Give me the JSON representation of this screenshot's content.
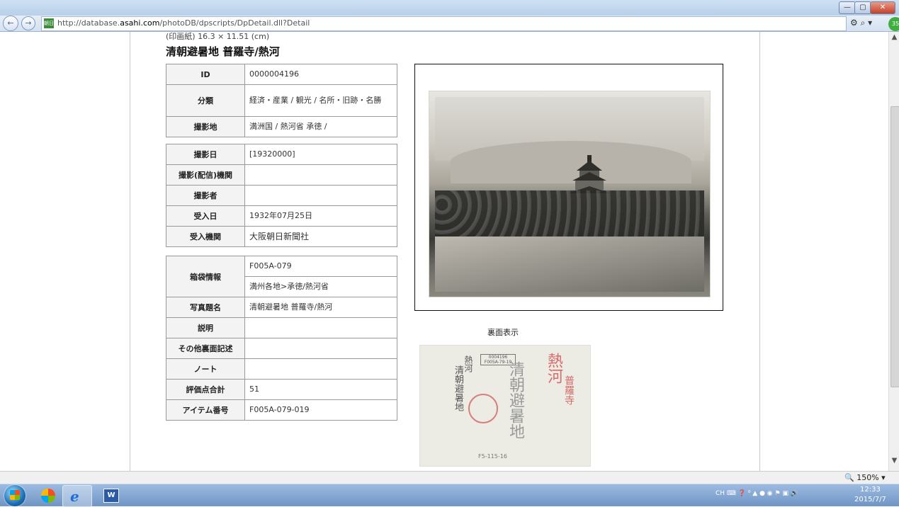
{
  "browser": {
    "url_prefix": "http://database.",
    "url_domain": "asahi.com",
    "url_path": "/photoDB/dpscripts/DpDetail.dll?Detail",
    "site_icon_text": "朝日",
    "green_badge": "35",
    "tools_text": "⚙ ⌕ ▾",
    "minimize_label": "—",
    "maximize_label": "▢",
    "close_label": "✕",
    "back_label": "←",
    "forward_label": "→"
  },
  "page": {
    "size_line": "(印画紙)  16.3 × 11.51 (cm)",
    "title": "清朝避暑地 普羅寺/熱河",
    "back_label": "裏面表示"
  },
  "table_1": [
    {
      "k": "ID",
      "v": "0000004196"
    },
    {
      "k": "分類",
      "v": "経済・産業 / 観光 / 名所・旧跡・名勝"
    },
    {
      "k": "撮影地",
      "v": "満洲国 / 熱河省 承徳 /"
    }
  ],
  "table_2": [
    {
      "k": "撮影日",
      "v": "[19320000]"
    },
    {
      "k": "撮影(配信)機関",
      "v": ""
    },
    {
      "k": "撮影者",
      "v": ""
    },
    {
      "k": "受入日",
      "v": "1932年07月25日"
    },
    {
      "k": "受入機関",
      "v": "大阪朝日新聞社"
    }
  ],
  "table_3": {
    "box_key": "箱袋情報",
    "box_values": [
      "F005A-079",
      "満州各地>承徳/熱河省"
    ],
    "rows": [
      {
        "k": "写真題名",
        "v": "清朝避暑地 普羅寺/熱河"
      },
      {
        "k": "説明",
        "v": ""
      },
      {
        "k": "その他裏面記述",
        "v": ""
      },
      {
        "k": "ノート",
        "v": ""
      },
      {
        "k": "評価点合計",
        "v": "51"
      },
      {
        "k": "アイテム番号",
        "v": "F005A-079-019"
      }
    ]
  },
  "back_photo": {
    "label_box": "0004196 F005A-79-19",
    "ink_col1": "清朝避暑地",
    "ink_col2": "熱河",
    "ink_col3": "清朝避暑地",
    "red_col1": "熱河",
    "red_col2": "普羅寺",
    "number": "F5-115-16"
  },
  "statusbar": {
    "zoom": "🔍 150%  ▾"
  },
  "taskbar": {
    "ie_glyph": "e",
    "word_glyph": "W",
    "tray_text": "CH ⌨ ❓ ⁰ ▲ ● ◉ ⚑ ▣ 🔊",
    "time": "12:33",
    "date": "2015/7/7"
  },
  "colors": {
    "accent": "#1e6fb5",
    "taskbar": "#6f95c6"
  }
}
